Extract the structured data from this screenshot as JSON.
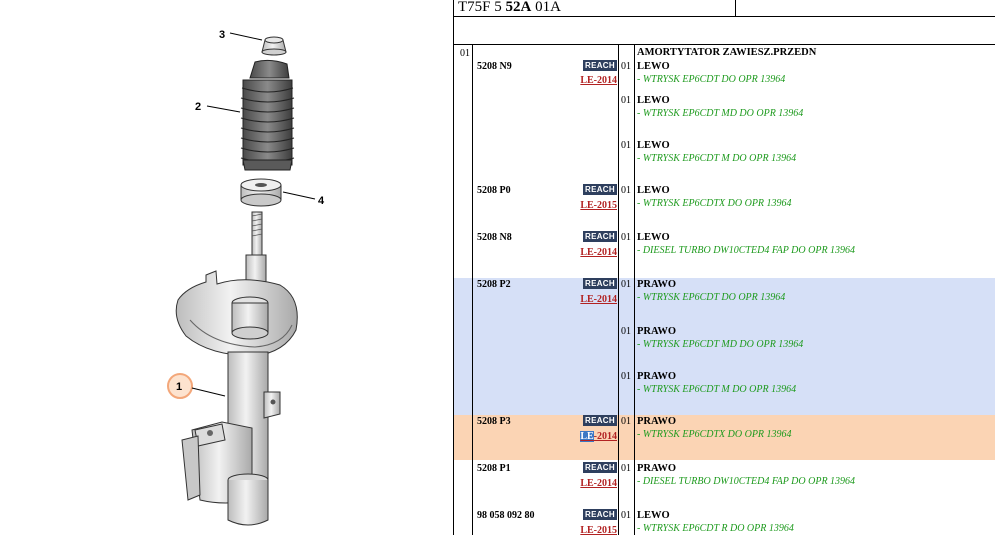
{
  "diagram": {
    "callouts": [
      "3",
      "2",
      "4",
      "1"
    ]
  },
  "header": {
    "ref_prefix": "T75F 5",
    "ref_bold": "52A",
    "ref_suffix": "01A"
  },
  "table": {
    "group_number": "01",
    "group_title": "AMORTYTATOR ZAWIESZ.PRZEDN",
    "colors": {
      "highlight_blue": "#d6e0f7",
      "highlight_orange": "#fbd4b4",
      "reach_badge": "#2e3f5e",
      "le_red": "#b22222",
      "cond_green": "#1d9a1d"
    },
    "rows": [
      {
        "part_number": "5208 N9",
        "reach": "REACH",
        "le": "LE-2014",
        "lines": [
          {
            "qty": "01",
            "side": "LEWO",
            "condition": "- WTRYSK EP6CDT DO OPR 13964"
          },
          {
            "qty": "01",
            "side": "LEWO",
            "condition": "- WTRYSK EP6CDT MD DO OPR 13964"
          },
          {
            "qty": "01",
            "side": "LEWO",
            "condition": "- WTRYSK EP6CDT M DO OPR 13964"
          }
        ]
      },
      {
        "part_number": "5208 P0",
        "reach": "REACH",
        "le": "LE-2015",
        "lines": [
          {
            "qty": "01",
            "side": "LEWO",
            "condition": "- WTRYSK EP6CDTX DO OPR 13964"
          }
        ]
      },
      {
        "part_number": "5208 N8",
        "reach": "REACH",
        "le": "LE-2014",
        "lines": [
          {
            "qty": "01",
            "side": "LEWO",
            "condition": "- DIESEL TURBO DW10CTED4 FAP DO OPR 13964"
          }
        ]
      },
      {
        "part_number": "5208 P2",
        "reach": "REACH",
        "le": "LE-2014",
        "lines": [
          {
            "qty": "01",
            "side": "PRAWO",
            "condition": "- WTRYSK EP6CDT DO OPR 13964"
          },
          {
            "qty": "01",
            "side": "PRAWO",
            "condition": "- WTRYSK EP6CDT MD DO OPR 13964"
          },
          {
            "qty": "01",
            "side": "PRAWO",
            "condition": "- WTRYSK EP6CDT M DO OPR 13964"
          }
        ]
      },
      {
        "part_number": "5208 P3",
        "reach": "REACH",
        "le_selected": "LE",
        "le_rest": "-2014",
        "lines": [
          {
            "qty": "01",
            "side": "PRAWO",
            "condition": "- WTRYSK EP6CDTX DO OPR 13964"
          }
        ]
      },
      {
        "part_number": "5208 P1",
        "reach": "REACH",
        "le": "LE-2014",
        "lines": [
          {
            "qty": "01",
            "side": "PRAWO",
            "condition": "- DIESEL TURBO DW10CTED4 FAP DO OPR 13964"
          }
        ]
      },
      {
        "part_number": "98 058 092 80",
        "reach": "REACH",
        "le": "LE-2015",
        "lines": [
          {
            "qty": "01",
            "side": "LEWO",
            "condition": "- WTRYSK EP6CDT R DO OPR 13964"
          }
        ]
      }
    ]
  }
}
